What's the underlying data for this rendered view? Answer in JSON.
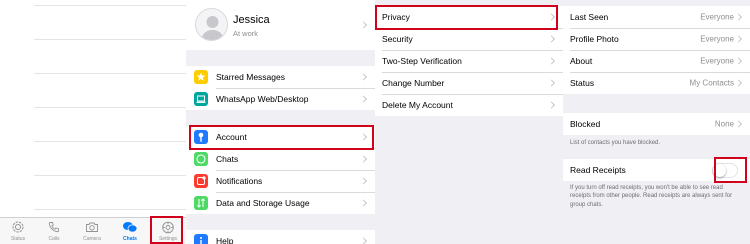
{
  "tab_bar": {
    "tabs": [
      {
        "label": "Status",
        "icon": "status-icon"
      },
      {
        "label": "Calls",
        "icon": "phone-icon"
      },
      {
        "label": "Camera",
        "icon": "camera-icon"
      },
      {
        "label": "Chats",
        "icon": "chats-icon"
      },
      {
        "label": "Settings",
        "icon": "gear-icon"
      }
    ],
    "active": "Chats"
  },
  "settings": {
    "profile": {
      "name": "Jessica",
      "status": "At work"
    },
    "items": [
      {
        "label": "Starred Messages",
        "icon": "star-icon",
        "color": "#ffcc00"
      },
      {
        "label": "WhatsApp Web/Desktop",
        "icon": "laptop-icon",
        "color": "#00a69c"
      },
      {
        "label": "Account",
        "icon": "key-icon",
        "color": "#1f7aff"
      },
      {
        "label": "Chats",
        "icon": "whatsapp-icon",
        "color": "#4cd964"
      },
      {
        "label": "Notifications",
        "icon": "notification-icon",
        "color": "#ff3b30"
      },
      {
        "label": "Data and Storage Usage",
        "icon": "data-arrows-icon",
        "color": "#4cd964"
      },
      {
        "label": "Help",
        "icon": "info-icon",
        "color": "#1f7aff"
      }
    ]
  },
  "account": {
    "items": [
      {
        "label": "Privacy"
      },
      {
        "label": "Security"
      },
      {
        "label": "Two-Step Verification"
      },
      {
        "label": "Change Number"
      },
      {
        "label": "Delete My Account"
      }
    ]
  },
  "privacy": {
    "items": [
      {
        "label": "Last Seen",
        "value": "Everyone"
      },
      {
        "label": "Profile Photo",
        "value": "Everyone"
      },
      {
        "label": "About",
        "value": "Everyone"
      },
      {
        "label": "Status",
        "value": "My Contacts"
      }
    ],
    "blocked": {
      "label": "Blocked",
      "value": "None"
    },
    "blocked_note": "List of contacts you have blocked.",
    "read_receipts": {
      "label": "Read Receipts",
      "enabled": false
    },
    "read_receipts_note": "If you turn off read receipts, you won't be able to see read receipts from other people. Read receipts are always sent for group chats."
  },
  "colors": {
    "highlight": "#d0021b",
    "accent": "#007aff",
    "background": "#efeff4"
  }
}
